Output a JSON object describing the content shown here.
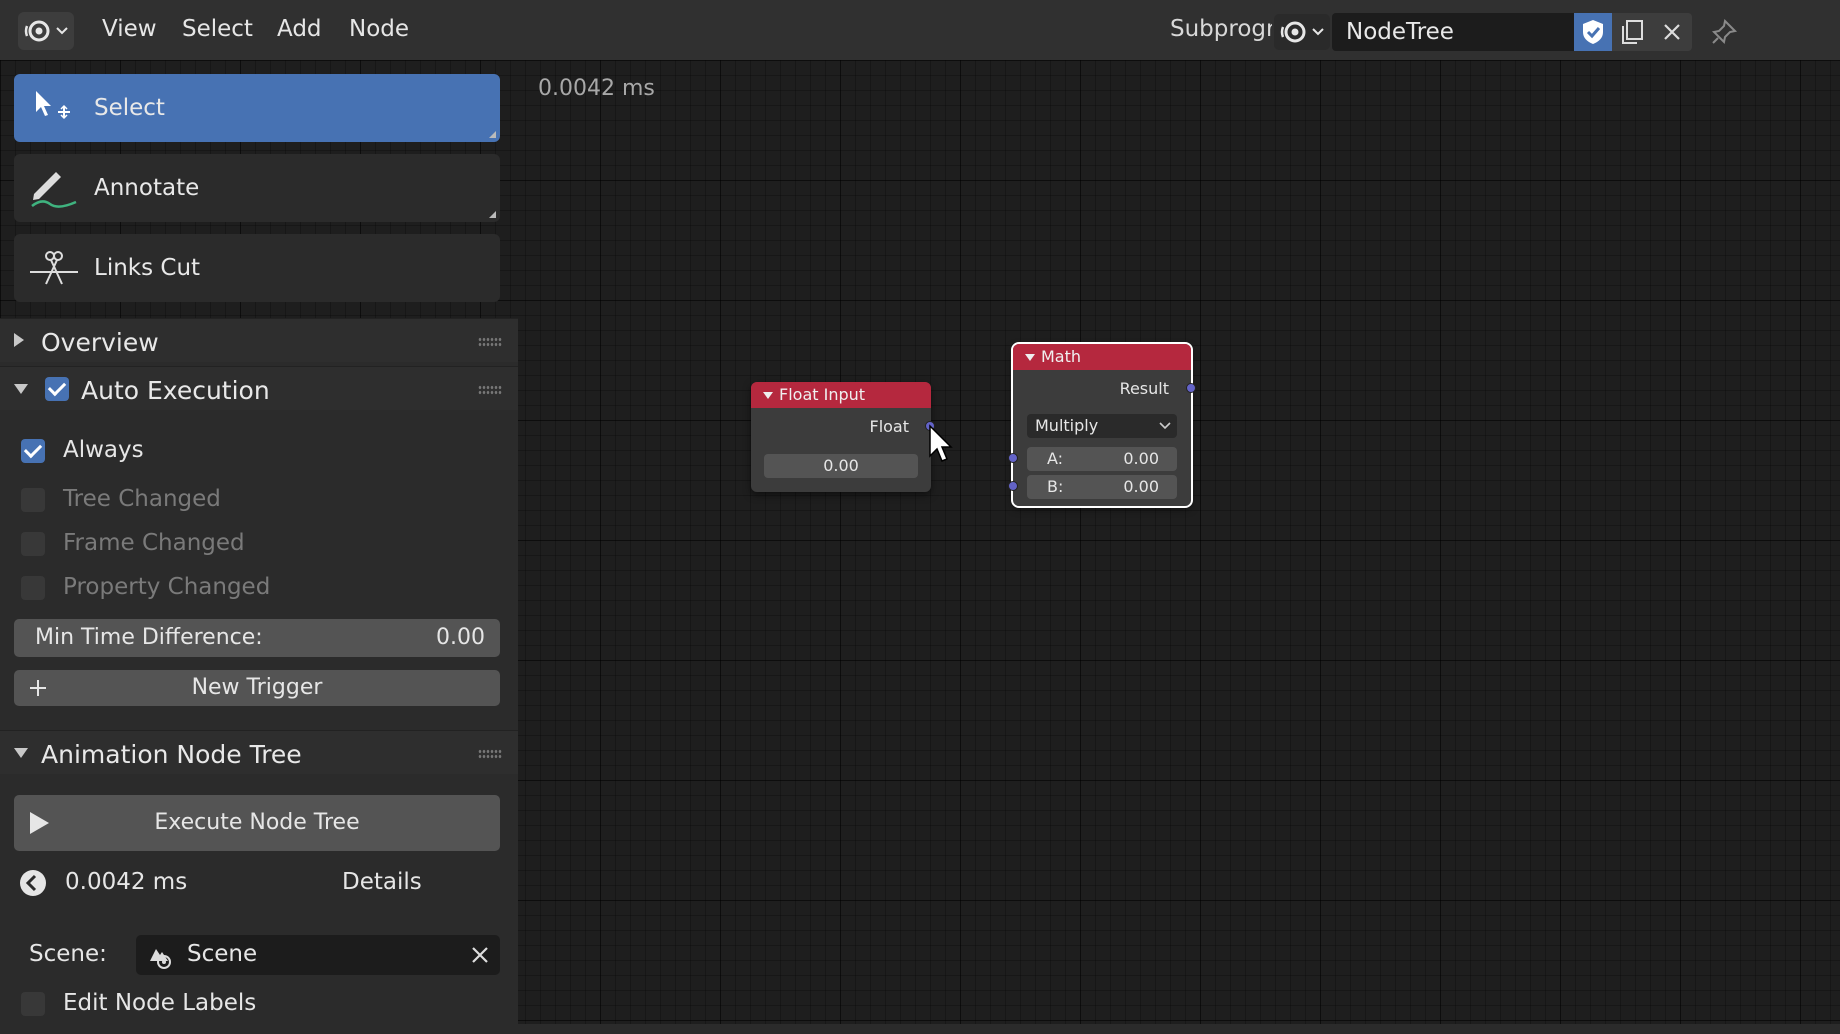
{
  "header": {
    "editor_type_icon": "node-editor-icon",
    "menus": [
      "View",
      "Select",
      "Add",
      "Node"
    ],
    "subprogram_label": "Subprogra",
    "node_tree_name": "NodeTree",
    "icons": {
      "tree_type": "node-tree-type-icon",
      "fake_user": "shield-check-icon",
      "duplicate": "duplicate-icon",
      "unlink": "close-icon",
      "pin": "pin-icon"
    }
  },
  "overlay": {
    "exec_time": "0.0042 ms"
  },
  "tools": [
    {
      "label": "Select",
      "icon": "select-cursor-icon",
      "active": true
    },
    {
      "label": "Annotate",
      "icon": "annotate-pen-icon",
      "active": false
    },
    {
      "label": "Links Cut",
      "icon": "links-cut-icon",
      "active": false
    }
  ],
  "sidebar": {
    "overview": {
      "label": "Overview",
      "expanded": false
    },
    "auto_execution": {
      "label": "Auto Execution",
      "enabled": true,
      "always": {
        "label": "Always",
        "checked": true
      },
      "tree_changed": {
        "label": "Tree Changed",
        "checked": false
      },
      "frame_changed": {
        "label": "Frame Changed",
        "checked": false
      },
      "property_changed": {
        "label": "Property Changed",
        "checked": false
      },
      "min_time": {
        "label": "Min Time Difference:",
        "value": "0.00"
      },
      "new_trigger": {
        "label": "New Trigger",
        "icon": "plus-icon"
      }
    },
    "animation_node_tree": {
      "label": "Animation Node Tree",
      "execute": {
        "label": "Execute Node Tree",
        "icon": "play-icon"
      },
      "time": {
        "value": "0.0042 ms",
        "icon": "timer-icon"
      },
      "details": "Details",
      "scene_label": "Scene:",
      "scene_value": "Scene",
      "scene_icon": "scene-icon",
      "edit_labels": {
        "label": "Edit Node Labels",
        "checked": false
      }
    }
  },
  "nodes": {
    "float_input": {
      "title": "Float Input",
      "output": "Float",
      "value": "0.00",
      "header_color": "#b5283e"
    },
    "math": {
      "title": "Math",
      "output": "Result",
      "operation": "Multiply",
      "a_label": "A:",
      "a_value": "0.00",
      "b_label": "B:",
      "b_value": "0.00",
      "selected": true
    }
  },
  "colors": {
    "accent": "#4772b3",
    "node_header": "#b5283e",
    "socket": "#6363c7"
  }
}
